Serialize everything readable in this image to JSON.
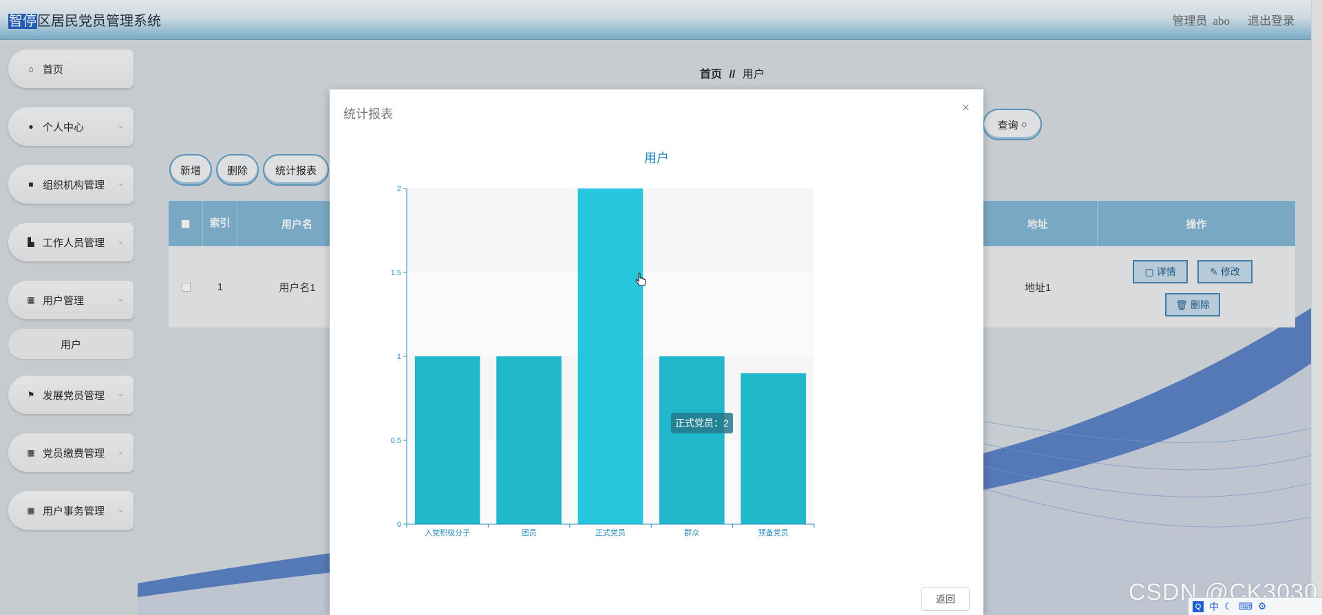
{
  "app": {
    "title_highlight": "智停",
    "title_rest": "区居民党员管理系统",
    "user_label": "管理员",
    "user_name": "abo",
    "logout_label": "退出登录"
  },
  "sidebar": {
    "items": [
      {
        "label": "首页",
        "icon": "home-icon"
      },
      {
        "label": "个人中心",
        "icon": "user-icon"
      },
      {
        "label": "组织机构管理",
        "icon": "briefcase-icon"
      },
      {
        "label": "工作人员管理",
        "icon": "chart-icon"
      },
      {
        "label": "用户管理",
        "icon": "grid-icon"
      },
      {
        "label": "用户",
        "sub": true
      },
      {
        "label": "发展党员管理",
        "icon": "flag-icon"
      },
      {
        "label": "党员缴费管理",
        "icon": "grid-icon"
      },
      {
        "label": "用户事务管理",
        "icon": "grid-icon"
      }
    ]
  },
  "breadcrumb": {
    "home": "首页",
    "sep": "//",
    "current": "用户"
  },
  "toolbar": {
    "add": "新增",
    "delete": "删除",
    "stats": "统计报表",
    "query": "查询"
  },
  "table": {
    "headers": [
      "索引",
      "用户名",
      "地址",
      "操作"
    ],
    "rows": [
      {
        "index": "1",
        "username": "用户名1",
        "address": "地址1"
      }
    ],
    "actions": {
      "detail": "详情",
      "edit": "修改",
      "delete": "删除"
    }
  },
  "modal": {
    "title": "统计报表",
    "back": "返回",
    "tooltip": "正式党员：2"
  },
  "chart_data": {
    "type": "bar",
    "title": "用户",
    "categories": [
      "入党积极分子",
      "团员",
      "正式党员",
      "群众",
      "预备党员"
    ],
    "values": [
      1,
      1,
      2,
      1,
      0.9
    ],
    "ylim": [
      0,
      2
    ],
    "yticks": [
      "0",
      "0.5",
      "1",
      "1.5",
      "2"
    ],
    "bar_color": "#22b8cc",
    "highlight_color": "#26c6dd",
    "axis_color": "#2a8ec0",
    "grid": true
  },
  "watermark": "CSDN @CK3030",
  "tray": {
    "ime": "中"
  }
}
